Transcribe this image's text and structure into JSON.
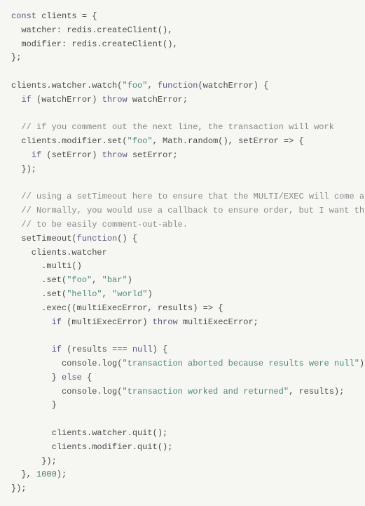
{
  "code": {
    "l01_a": "const",
    "l01_b": " clients = {",
    "l02_a": "  watcher: redis.createClient(),",
    "l03_a": "  modifier: redis.createClient(),",
    "l04_a": "};",
    "l05_a": "",
    "l06_a": "clients.watcher.watch(",
    "l06_b": "\"foo\"",
    "l06_c": ", ",
    "l06_d": "function",
    "l06_e": "(watchError) {",
    "l07_a": "  ",
    "l07_b": "if",
    "l07_c": " (watchError) ",
    "l07_d": "throw",
    "l07_e": " watchError;",
    "l08_a": "",
    "l09_a": "  ",
    "l09_b": "// if you comment out the next line, the transaction will work",
    "l10_a": "  clients.modifier.set(",
    "l10_b": "\"foo\"",
    "l10_c": ", Math.random(), setError => {",
    "l11_a": "    ",
    "l11_b": "if",
    "l11_c": " (setError) ",
    "l11_d": "throw",
    "l11_e": " setError;",
    "l12_a": "  });",
    "l13_a": "",
    "l14_a": "  ",
    "l14_b": "// using a setTimeout here to ensure that the MULTI/EXEC will come after the SET.",
    "l15_a": "  ",
    "l15_b": "// Normally, you would use a callback to ensure order, but I want the above SET command",
    "l16_a": "  ",
    "l16_b": "// to be easily comment-out-able.",
    "l17_a": "  setTimeout(",
    "l17_b": "function",
    "l17_c": "() {",
    "l18_a": "    clients.watcher",
    "l19_a": "      .multi()",
    "l20_a": "      .set(",
    "l20_b": "\"foo\"",
    "l20_c": ", ",
    "l20_d": "\"bar\"",
    "l20_e": ")",
    "l21_a": "      .set(",
    "l21_b": "\"hello\"",
    "l21_c": ", ",
    "l21_d": "\"world\"",
    "l21_e": ")",
    "l22_a": "      .exec((multiExecError, results) => {",
    "l23_a": "        ",
    "l23_b": "if",
    "l23_c": " (multiExecError) ",
    "l23_d": "throw",
    "l23_e": " multiExecError;",
    "l24_a": "",
    "l25_a": "        ",
    "l25_b": "if",
    "l25_c": " (results === ",
    "l25_d": "null",
    "l25_e": ") {",
    "l26_a": "          console.log(",
    "l26_b": "\"transaction aborted because results were null\"",
    "l26_c": ");",
    "l27_a": "        } ",
    "l27_b": "else",
    "l27_c": " {",
    "l28_a": "          console.log(",
    "l28_b": "\"transaction worked and returned\"",
    "l28_c": ", results);",
    "l29_a": "        }",
    "l30_a": "",
    "l31_a": "        clients.watcher.quit();",
    "l32_a": "        clients.modifier.quit();",
    "l33_a": "      });",
    "l34_a": "  }, ",
    "l34_b": "1000",
    "l34_c": ");",
    "l35_a": "});"
  }
}
